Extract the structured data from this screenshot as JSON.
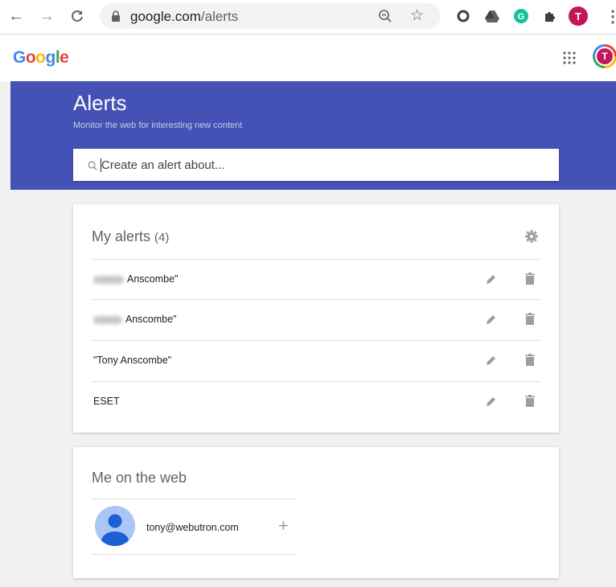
{
  "browser": {
    "url_host": "google.com",
    "url_path": "/alerts",
    "profile_initial": "T",
    "menu_glyph": "⋮"
  },
  "header": {
    "logo": "Google",
    "avatar_initial": "T"
  },
  "banner": {
    "title": "Alerts",
    "subtitle": "Monitor the web for interesting new content",
    "search_placeholder": "Create an alert about..."
  },
  "my_alerts": {
    "title": "My alerts",
    "count": "(4)",
    "items": [
      {
        "label": "Anscombe\"",
        "redacted": true
      },
      {
        "label": "Anscombe\"",
        "redacted": true
      },
      {
        "label": "\"Tony Anscombe\"",
        "redacted": false
      },
      {
        "label": "ESET",
        "redacted": false
      }
    ]
  },
  "me_on_web": {
    "title": "Me on the web",
    "email": "tony@webutron.com",
    "add_glyph": "+"
  },
  "colors": {
    "banner": "#4352b4",
    "profile": "#c2185b"
  }
}
